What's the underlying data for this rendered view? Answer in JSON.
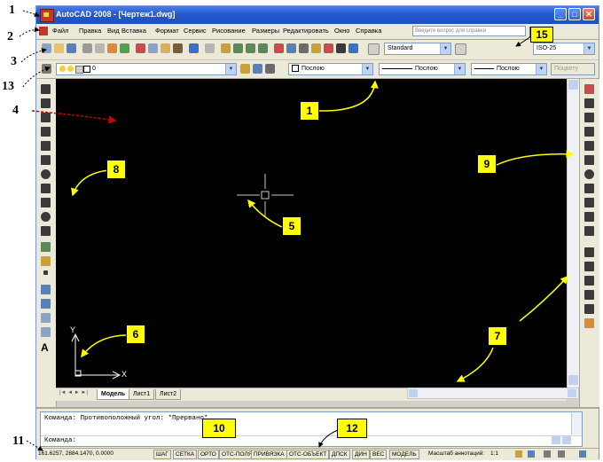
{
  "window": {
    "title": "AutoCAD 2008 - [Чертеж1.dwg]",
    "minimize": "_",
    "maximize": "□",
    "close": "✕"
  },
  "menubar": {
    "items": [
      "Файл",
      "Правка",
      "Вид",
      "Вставка",
      "Формат",
      "Сервис",
      "Рисование",
      "Размеры",
      "Редактировать",
      "Окно",
      "Справка"
    ],
    "search_placeholder": "Введите вопрос для справки"
  },
  "toolbar": {
    "text_style": "Standard",
    "dim_style": "ISO-25",
    "layer": "0",
    "color": "Послою",
    "linetype": "Послою",
    "lineweight": "Послою",
    "plot_style": "Поцвету"
  },
  "drawing": {
    "ucs_y": "Y",
    "ucs_x": "X",
    "tabs": [
      "Модель",
      "Лист1",
      "Лист2"
    ]
  },
  "command": {
    "line1": "Команда: Противоположный угол: *Прервано*",
    "line2": "Команда:"
  },
  "status": {
    "coords": "161.6257,  2884.1470, 0.0000",
    "toggles": [
      "ШАГ",
      "СЕТКА",
      "ОРТО",
      "ОТС-ПОЛЯР",
      "ПРИВЯЗКА",
      "ОТС-ОБЪЕКТ",
      "ДПСК",
      "ДИН",
      "ВЕС",
      "МОДЕЛЬ"
    ],
    "annotation_scale_label": "Масштаб аннотаций:",
    "annotation_scale": "1:1"
  },
  "annotations": {
    "outside": [
      "1",
      "2",
      "3",
      "13",
      "4",
      "11"
    ],
    "boxes": [
      "1",
      "8",
      "5",
      "9",
      "6",
      "7",
      "10",
      "12",
      "15"
    ]
  },
  "colors": {
    "title_bar": "#2458d0",
    "canvas": "#000000",
    "callout": "#ffff00",
    "arrow": "#ffff00",
    "arrow4": "#cc0000"
  }
}
